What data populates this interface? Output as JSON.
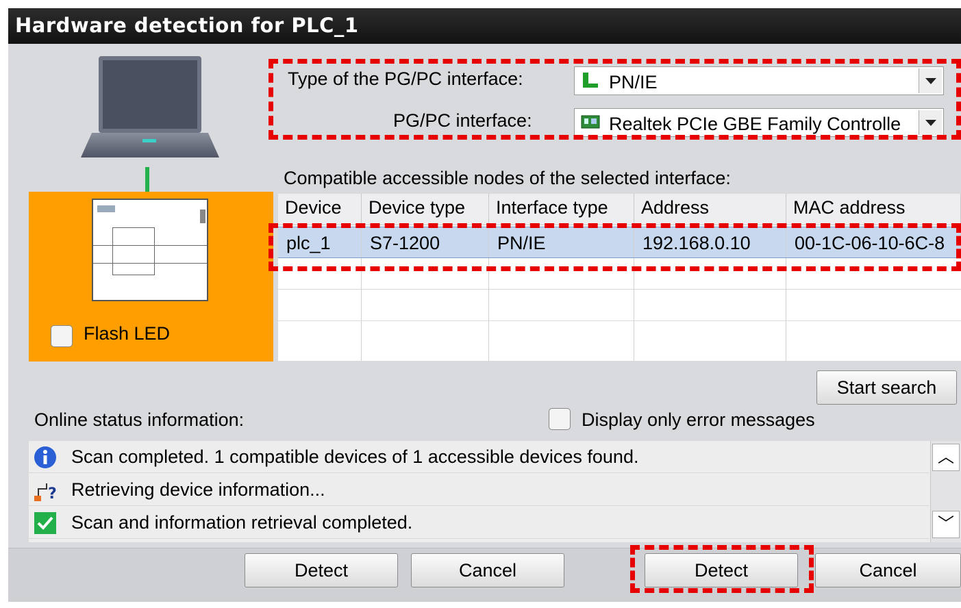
{
  "window": {
    "title": "Hardware detection for PLC_1"
  },
  "device_panel": {
    "flash_led_label": "Flash LED"
  },
  "interface": {
    "type_label": "Type of the PG/PC interface:",
    "type_value": "PN/IE",
    "pgpc_label": "PG/PC interface:",
    "pgpc_value": "Realtek PCIe GBE Family Controlle"
  },
  "nodes": {
    "heading": "Compatible accessible nodes of the selected interface:",
    "columns": [
      "Device",
      "Device type",
      "Interface type",
      "Address",
      "MAC address"
    ],
    "rows": [
      [
        "plc_1",
        "S7-1200",
        "PN/IE",
        "192.168.0.10",
        "00-1C-06-10-6C-8"
      ]
    ]
  },
  "search": {
    "start_label": "Start search"
  },
  "online_status": {
    "label": "Online status information:",
    "error_only_label": "Display only error messages",
    "messages": [
      {
        "icon": "info-icon",
        "text": "Scan completed. 1 compatible devices of 1 accessible devices found."
      },
      {
        "icon": "network-query-icon",
        "text": "Retrieving device information..."
      },
      {
        "icon": "checkmark-icon",
        "text": "Scan and information retrieval completed."
      }
    ]
  },
  "buttons": {
    "detect_1": "Detect",
    "cancel_1": "Cancel",
    "detect_2": "Detect",
    "cancel_2": "Cancel"
  },
  "colors": {
    "title_bar": "#1a1a1a",
    "highlight_box": "#e60000",
    "device_panel": "#ff9e00",
    "selected_row": "#c7d8ef"
  }
}
